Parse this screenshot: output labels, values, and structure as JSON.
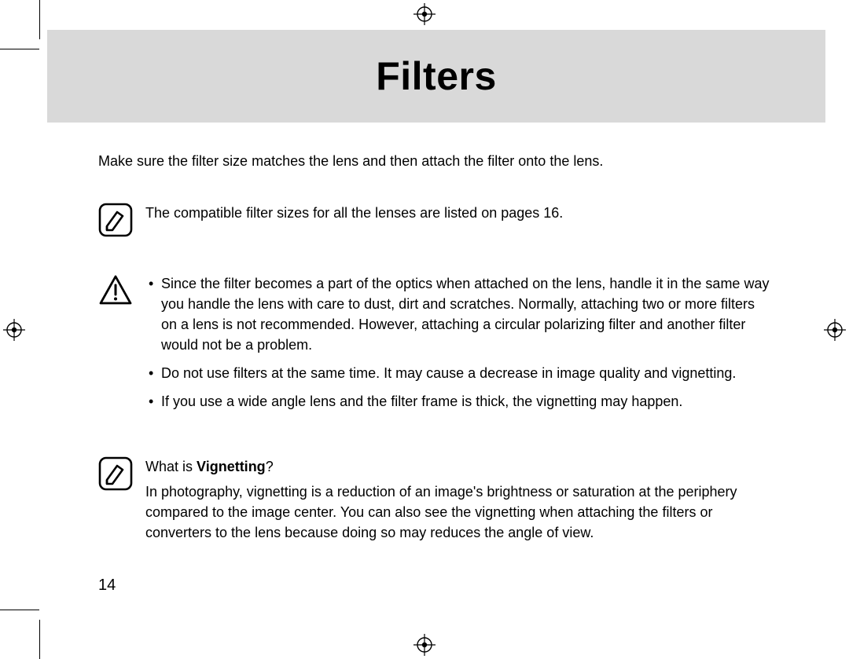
{
  "title": "Filters",
  "intro": "Make sure the filter size matches the lens and then attach the filter onto the lens.",
  "note1": "The compatible filter sizes for all the lenses are listed on pages 16.",
  "cautions": [
    "Since the filter becomes a part of the optics when attached on the lens, handle it in the same way you handle the lens with care to dust, dirt and scratches. Normally, attaching two or more filters on a lens is not recommended. However, attaching a circular polarizing filter and another filter would not be a problem.",
    "Do not use filters at the same time. It may cause a decrease in image quality and vignetting.",
    "If you use a wide angle lens and the filter frame is thick, the vignetting may happen."
  ],
  "note2": {
    "question_prefix": "What is ",
    "question_term": "Vignetting",
    "question_suffix": "?",
    "answer": "In photography, vignetting is a reduction of an image's brightness or saturation at the periphery compared to the image center. You can also see the vignetting when attaching the filters or converters to the lens because doing so may reduces the angle of view."
  },
  "page_number": "14"
}
